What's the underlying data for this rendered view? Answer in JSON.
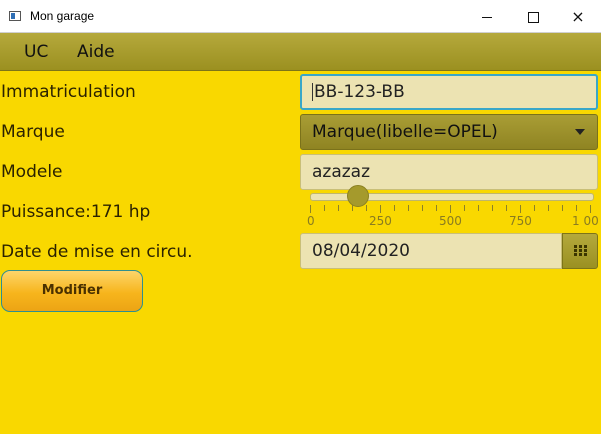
{
  "window": {
    "title": "Mon garage",
    "icon": "app-window-icon",
    "controls": {
      "minimize": "minimize-icon",
      "maximize": "maximize-icon",
      "close": "×"
    }
  },
  "menu": {
    "items": [
      "UC",
      "Aide"
    ]
  },
  "form": {
    "immatriculation": {
      "label": "Immatriculation",
      "value": "BB-123-BB"
    },
    "marque": {
      "label": "Marque",
      "value": "Marque(libelle=OPEL)"
    },
    "modele": {
      "label": "Modele",
      "value": "azazaz"
    },
    "puissance": {
      "label": "Puissance:171 hp",
      "value": 171,
      "min": 0,
      "max": 1000,
      "ticks": [
        "0",
        "250",
        "500",
        "750",
        "1 00"
      ]
    },
    "date": {
      "label": "Date de mise en circu.",
      "value": "08/04/2020",
      "icon": "calendar-icon"
    },
    "modify_button": "Modifier"
  },
  "colors": {
    "background": "#f9d800",
    "menubar": "#a89d30",
    "focus": "#39a7c8",
    "button": "#f7b51c"
  }
}
